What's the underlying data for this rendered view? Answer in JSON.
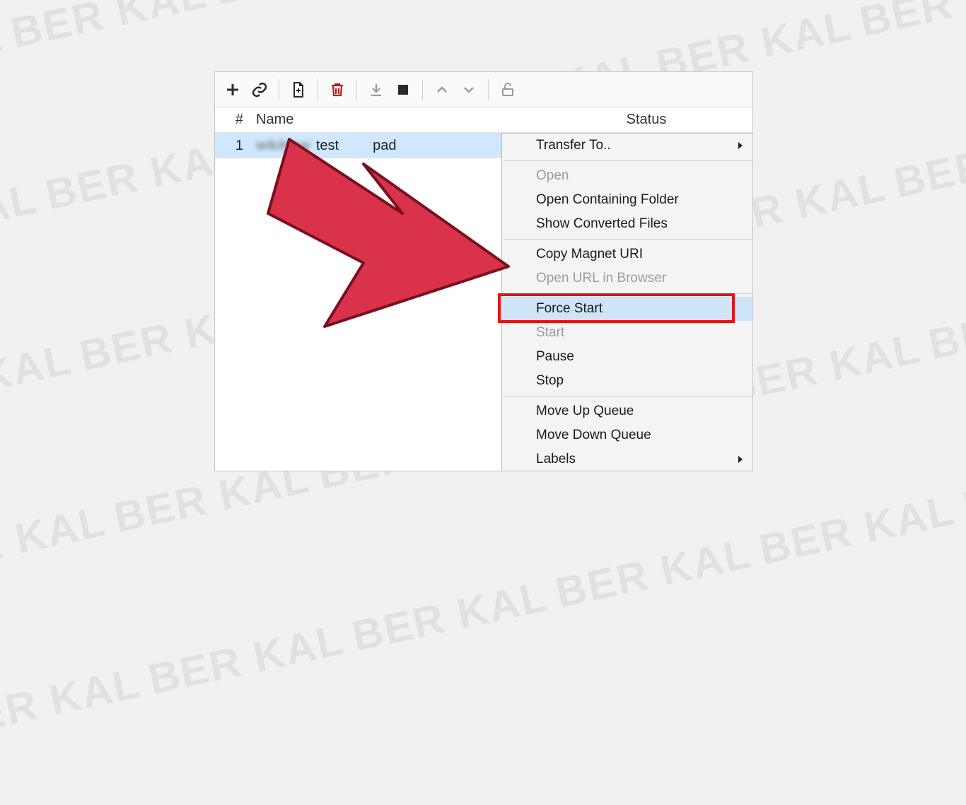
{
  "watermark": "BER   KAL",
  "toolbar": {
    "add_icon": "add-icon",
    "link_icon": "link-icon",
    "file_icon": "file-icon",
    "delete_icon": "trash-icon",
    "download_icon": "download-icon",
    "stop_icon": "stop-icon",
    "up_icon": "chevron-up-icon",
    "down_icon": "chevron-down-icon",
    "lock_icon": "unlock-icon"
  },
  "columns": {
    "num": "#",
    "name": "Name",
    "status": "Status"
  },
  "row": {
    "index": "1",
    "name_hidden": "wikiHow",
    "name_visible": "test",
    "name_trail": "pad"
  },
  "menu": {
    "transfer_to": "Transfer To..",
    "open": "Open",
    "open_folder": "Open Containing Folder",
    "show_converted": "Show Converted Files",
    "copy_magnet": "Copy Magnet URI",
    "open_url": "Open URL in Browser",
    "force_start": "Force Start",
    "start": "Start",
    "pause": "Pause",
    "stop": "Stop",
    "move_up": "Move Up Queue",
    "move_down": "Move Down Queue",
    "labels": "Labels"
  }
}
